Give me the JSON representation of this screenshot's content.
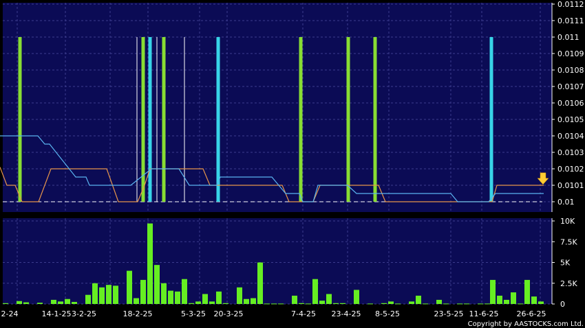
{
  "chart_data": [
    {
      "type": "line",
      "panel": "price",
      "ylim": [
        0.01,
        0.0112
      ],
      "y_ticks": [
        "0.0112",
        "0.0111",
        "0.011",
        "0.0109",
        "0.0108",
        "0.0107",
        "0.0106",
        "0.0105",
        "0.0104",
        "0.0103",
        "0.0102",
        "0.0101",
        "0.01"
      ],
      "grid": true,
      "series": [
        {
          "color": "#e8964a",
          "points": [
            [
              0,
              0.01021
            ],
            [
              10,
              0.0101
            ],
            [
              22,
              0.0101
            ],
            [
              32,
              0.01
            ],
            [
              56,
              0.01
            ],
            [
              74,
              0.0102
            ],
            [
              155,
              0.0102
            ],
            [
              172,
              0.01
            ],
            [
              200,
              0.01
            ],
            [
              210,
              0.0101
            ],
            [
              218,
              0.0102
            ],
            [
              295,
              0.0102
            ],
            [
              305,
              0.0101
            ],
            [
              410,
              0.0101
            ],
            [
              420,
              0.01
            ],
            [
              455,
              0.01
            ],
            [
              465,
              0.0101
            ],
            [
              550,
              0.0101
            ],
            [
              560,
              0.01
            ],
            [
              715,
              0.01
            ],
            [
              722,
              0.0101
            ],
            [
              790,
              0.0101
            ]
          ]
        },
        {
          "color": "#5ab4f0",
          "points": [
            [
              0,
              0.0104
            ],
            [
              55,
              0.0104
            ],
            [
              65,
              0.01035
            ],
            [
              72,
              0.01035
            ],
            [
              110,
              0.01015
            ],
            [
              125,
              0.01015
            ],
            [
              130,
              0.0101
            ],
            [
              190,
              0.0101
            ],
            [
              205,
              0.01015
            ],
            [
              220,
              0.0102
            ],
            [
              260,
              0.0102
            ],
            [
              275,
              0.0101
            ],
            [
              315,
              0.0101
            ],
            [
              320,
              0.01015
            ],
            [
              395,
              0.01015
            ],
            [
              415,
              0.01005
            ],
            [
              435,
              0.01005
            ],
            [
              440,
              0.01
            ],
            [
              455,
              0.01
            ],
            [
              462,
              0.0101
            ],
            [
              505,
              0.0101
            ],
            [
              518,
              0.01005
            ],
            [
              655,
              0.01005
            ],
            [
              665,
              0.01
            ],
            [
              710,
              0.01
            ],
            [
              720,
              0.01005
            ],
            [
              790,
              0.01005
            ]
          ]
        }
      ],
      "reference_line": {
        "value": 0.01,
        "color": "#ffffff"
      },
      "markers": [
        {
          "x": 29,
          "color": "#88dd33",
          "thick": true
        },
        {
          "x": 199,
          "color": "#ffffff",
          "thick": false
        },
        {
          "x": 208,
          "color": "#88dd33",
          "thick": true
        },
        {
          "x": 218,
          "color": "#38d4e8",
          "thick": true
        },
        {
          "x": 228,
          "color": "#ffffff",
          "thick": false
        },
        {
          "x": 238,
          "color": "#88dd33",
          "thick": true
        },
        {
          "x": 268,
          "color": "#ffffff",
          "thick": false
        },
        {
          "x": 317,
          "color": "#38d4e8",
          "thick": true
        },
        {
          "x": 437,
          "color": "#88dd33",
          "thick": true
        },
        {
          "x": 506,
          "color": "#88dd33",
          "thick": true
        },
        {
          "x": 545,
          "color": "#88dd33",
          "thick": true
        },
        {
          "x": 714,
          "color": "#38d4e8",
          "thick": true
        }
      ],
      "last_arrow_color": "#ffcc33"
    },
    {
      "type": "bar",
      "panel": "volume",
      "ylim": [
        0,
        10000
      ],
      "y_ticks": [
        "10K",
        "7.5K",
        "5K",
        "2.5K",
        "0"
      ],
      "bar_color": "#66ee22",
      "bars": [
        [
          8,
          100
        ],
        [
          28,
          350
        ],
        [
          38,
          200
        ],
        [
          58,
          150
        ],
        [
          78,
          500
        ],
        [
          88,
          300
        ],
        [
          98,
          600
        ],
        [
          108,
          250
        ],
        [
          128,
          1100
        ],
        [
          138,
          2500
        ],
        [
          148,
          2000
        ],
        [
          158,
          2300
        ],
        [
          168,
          2200
        ],
        [
          188,
          4000
        ],
        [
          198,
          700
        ],
        [
          208,
          2900
        ],
        [
          218,
          9700
        ],
        [
          228,
          4700
        ],
        [
          238,
          2500
        ],
        [
          248,
          1600
        ],
        [
          258,
          1500
        ],
        [
          268,
          3000
        ],
        [
          278,
          100
        ],
        [
          288,
          300
        ],
        [
          298,
          1200
        ],
        [
          308,
          300
        ],
        [
          318,
          1500
        ],
        [
          328,
          100
        ],
        [
          348,
          2000
        ],
        [
          358,
          600
        ],
        [
          368,
          700
        ],
        [
          378,
          5000
        ],
        [
          388,
          50
        ],
        [
          398,
          50
        ],
        [
          408,
          50
        ],
        [
          428,
          1000
        ],
        [
          438,
          100
        ],
        [
          448,
          50
        ],
        [
          458,
          3000
        ],
        [
          468,
          400
        ],
        [
          478,
          1200
        ],
        [
          488,
          100
        ],
        [
          498,
          100
        ],
        [
          518,
          1700
        ],
        [
          538,
          50
        ],
        [
          558,
          100
        ],
        [
          568,
          300
        ],
        [
          578,
          50
        ],
        [
          598,
          300
        ],
        [
          608,
          1000
        ],
        [
          618,
          50
        ],
        [
          638,
          500
        ],
        [
          648,
          50
        ],
        [
          668,
          50
        ],
        [
          678,
          50
        ],
        [
          698,
          50
        ],
        [
          708,
          50
        ],
        [
          716,
          2900
        ],
        [
          726,
          1000
        ],
        [
          736,
          500
        ],
        [
          746,
          1400
        ],
        [
          756,
          50
        ],
        [
          766,
          2900
        ],
        [
          776,
          900
        ],
        [
          786,
          300
        ]
      ]
    }
  ],
  "x_axis": {
    "tick_labels": [
      "2-24",
      "14-1-25",
      "3-2-25",
      "18-2-25",
      "5-3-25",
      "20-3-25",
      "7-4-25",
      "23-4-25",
      "8-5-25",
      "23-5-25",
      "11-6-25",
      "26-6-25"
    ]
  },
  "copyright": "Copyright by AASTOCKS.com Ltd.",
  "colors": {
    "background": "#0b0b55",
    "grid": "#3c3c8e",
    "axis_bg": "#000000"
  }
}
